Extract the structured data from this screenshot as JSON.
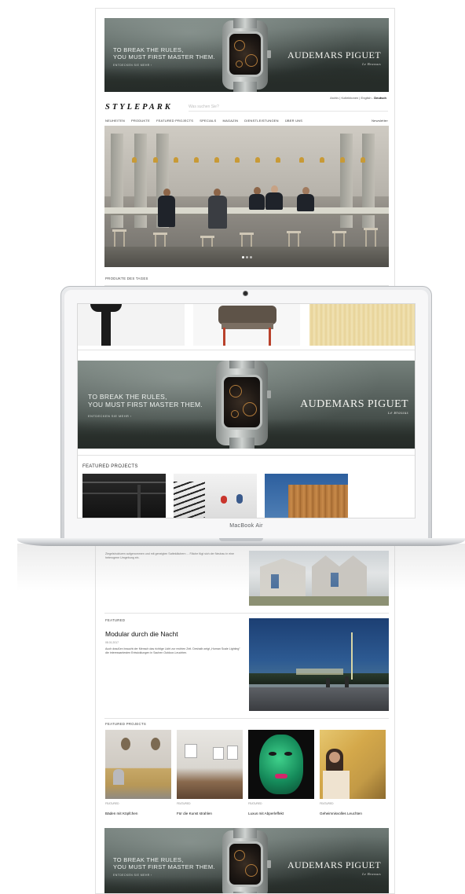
{
  "site": {
    "logo": "STYLEPARK",
    "search_placeholder": "Was suchen Sie?",
    "lang_links": "Archiv | Kollektionen | English - ",
    "lang_active": "Deutsch",
    "nav": [
      "NEUHEITEN",
      "PRODUKTE",
      "FEATURED PROJECTS",
      "SPECIALS",
      "MAGAZIN",
      "DIENSTLEISTUNGEN",
      "ÜBER UNS"
    ],
    "newsletter": "Newsletter"
  },
  "ad": {
    "line1": "TO BREAK THE RULES,",
    "line2": "YOU MUST FIRST MASTER THEM.",
    "cta": "ENTDECKEN SIE MEHR ›",
    "brand": "AUDEMARS PIGUET",
    "brand_sub": "Le Brassus"
  },
  "sections": {
    "products_today": "PRODUKTE DES TAGES",
    "featured_projects": "FEATURED PROJECTS",
    "featured": "FEATURED"
  },
  "article_snippet": "Ziegelstrukturen aufgenommen und mit geneigten Satteldächern ... Fläche fügt sich der Neubau in eine heterogene Umgebung ein.",
  "featured_article": {
    "title": "Modular durch die Nacht",
    "date": "08.01.2017",
    "text": "Auch draußen braucht der Mensch das richtige Licht zur rechten Zeit. Deshalb zeigt „Human Scale Lighting\" die interessantesten Entwicklungen in Sachen Outdoor-Leuchten."
  },
  "cards": [
    {
      "kicker": "FEATURED",
      "title": "Bäden mit Köpfchen"
    },
    {
      "kicker": "FEATURED",
      "title": "Für die Kunst strahlen"
    },
    {
      "kicker": "FEATURED",
      "title": "Luxus mit Abperleffekt"
    },
    {
      "kicker": "FEATURED",
      "title": "Geheimnisvolles Leuchten"
    }
  ],
  "laptop": {
    "model": "MacBook Air"
  }
}
